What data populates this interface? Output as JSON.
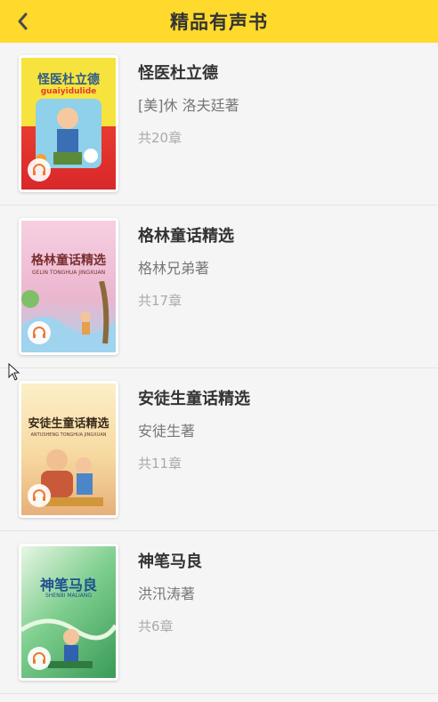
{
  "header": {
    "title": "精品有声书",
    "bg_color": "#ffd92c",
    "back_icon": "chevron-left-icon"
  },
  "books": [
    {
      "title": "怪医杜立德",
      "author": "[美]休 洛夫廷著",
      "chapters": "共20章",
      "cover_text": "怪医杜立德",
      "cover_subtext": "guaiyidulide",
      "cover_colors": [
        "#f6e13a",
        "#e63a2f",
        "#5aa8d8"
      ]
    },
    {
      "title": "格林童话精选",
      "author": "格林兄弟著",
      "chapters": "共17章",
      "cover_text": "格林童话精选",
      "cover_subtext": "GELIN TONGHUA JINGXUAN",
      "cover_colors": [
        "#f5c8dc",
        "#e7a7c4",
        "#8cc0e0"
      ]
    },
    {
      "title": "安徒生童话精选",
      "author": "安徒生著",
      "chapters": "共11章",
      "cover_text": "安徒生童话精选",
      "cover_subtext": "ANTUSHENG TONGHUA JINGXUAN",
      "cover_colors": [
        "#fbe9b8",
        "#f3c98a",
        "#e0784a"
      ]
    },
    {
      "title": "神笔马良",
      "author": "洪汛涛著",
      "chapters": "共6章",
      "cover_text": "神笔马良",
      "cover_subtext": "SHENBI MALIANG",
      "cover_colors": [
        "#7fcf8f",
        "#3f9f5a",
        "#dff3e0"
      ]
    }
  ]
}
